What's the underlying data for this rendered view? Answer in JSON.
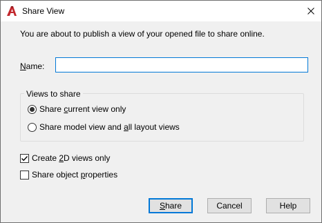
{
  "window": {
    "title": "Share View",
    "app_icon": "autocad-a-icon",
    "accent_color": "#c2272d"
  },
  "intro_text": "You are about to publish a view of your opened file to share online.",
  "name_field": {
    "label_prefix": "",
    "label_mnemonic": "N",
    "label_suffix": "ame:",
    "value": ""
  },
  "views_group": {
    "title": "Views to share",
    "options": [
      {
        "pre": "Share ",
        "mnemonic": "c",
        "post": "urrent view only",
        "selected": true
      },
      {
        "pre": "Share model view and ",
        "mnemonic": "a",
        "post": "ll layout views",
        "selected": false
      }
    ]
  },
  "checkboxes": [
    {
      "pre": "Create ",
      "mnemonic": "2",
      "post": "D views only",
      "checked": true
    },
    {
      "pre": "Share object ",
      "mnemonic": "p",
      "post": "roperties",
      "checked": false
    }
  ],
  "buttons": {
    "share": {
      "pre": "",
      "mnemonic": "S",
      "post": "hare"
    },
    "cancel": "Cancel",
    "help": "Help"
  }
}
